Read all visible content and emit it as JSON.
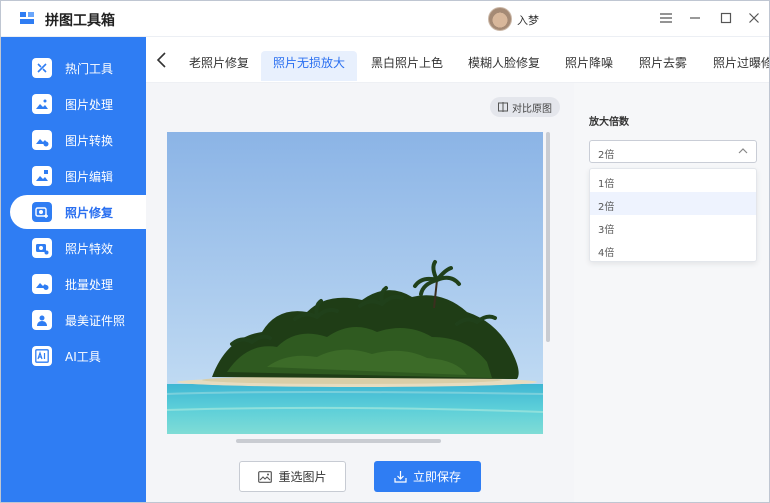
{
  "app": {
    "title": "拼图工具箱",
    "username": "入梦"
  },
  "window_controls": [
    "menu-icon",
    "minimize-icon",
    "maximize-icon",
    "close-icon"
  ],
  "sidebar": {
    "items": [
      {
        "label": "热门工具",
        "icon": "hot-tools-icon",
        "active": false
      },
      {
        "label": "图片处理",
        "icon": "image-process-icon",
        "active": false
      },
      {
        "label": "图片转换",
        "icon": "image-convert-icon",
        "active": false
      },
      {
        "label": "图片编辑",
        "icon": "image-edit-icon",
        "active": false
      },
      {
        "label": "照片修复",
        "icon": "photo-repair-icon",
        "active": true
      },
      {
        "label": "照片特效",
        "icon": "photo-effect-icon",
        "active": false
      },
      {
        "label": "批量处理",
        "icon": "batch-process-icon",
        "active": false
      },
      {
        "label": "最美证件照",
        "icon": "id-photo-icon",
        "active": false
      },
      {
        "label": "AI工具",
        "icon": "ai-tools-icon",
        "active": false
      }
    ]
  },
  "tabs": [
    {
      "label": "老照片修复",
      "active": false
    },
    {
      "label": "照片无损放大",
      "active": true
    },
    {
      "label": "黑白照片上色",
      "active": false
    },
    {
      "label": "模糊人脸修复",
      "active": false
    },
    {
      "label": "照片降噪",
      "active": false
    },
    {
      "label": "照片去雾",
      "active": false
    },
    {
      "label": "照片过曝修",
      "active": false
    }
  ],
  "main": {
    "compare_label": "对比原图",
    "reselect_label": "重选图片",
    "save_label": "立即保存"
  },
  "zoom": {
    "label": "放大倍数",
    "selected": "2倍",
    "options": [
      "1倍",
      "2倍",
      "3倍",
      "4倍"
    ],
    "highlighted_option": "2倍"
  },
  "colors": {
    "sidebar_bg": "#2f7df3",
    "accent": "#2a6ff0",
    "tab_active_bg": "#e8f0fd",
    "main_bg": "#f4f5f8"
  }
}
